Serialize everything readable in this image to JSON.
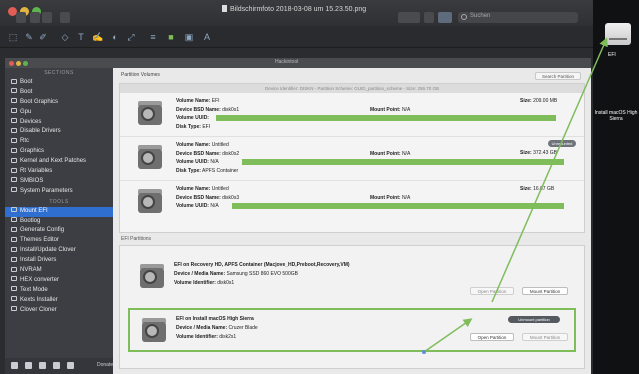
{
  "preview": {
    "document_title": "Bildschirmfoto 2018-03-08 um 15.23.50.png",
    "search_placeholder": "Suchen"
  },
  "app": {
    "window_title": "Hackintool",
    "sidebar": {
      "section_header": "SECTIONS",
      "items": [
        {
          "label": "Boot",
          "icon": "boot-icon"
        },
        {
          "label": "Boot",
          "icon": "boot-icon"
        },
        {
          "label": "Boot Graphics",
          "icon": "graphics-icon"
        },
        {
          "label": "Gpu",
          "icon": "gpu-icon"
        },
        {
          "label": "Devices",
          "icon": "devices-icon"
        },
        {
          "label": "Disable Drivers",
          "icon": "drivers-icon"
        },
        {
          "label": "Rtc",
          "icon": "rtc-icon"
        },
        {
          "label": "Graphics",
          "icon": "graphics-icon"
        },
        {
          "label": "Kernel and Kext Patches",
          "icon": "patch-icon"
        },
        {
          "label": "Rt Variables",
          "icon": "variables-icon"
        },
        {
          "label": "SMBIOS",
          "icon": "smbios-icon"
        },
        {
          "label": "System Parameters",
          "icon": "parameters-icon"
        }
      ],
      "tools_header": "TOOLS",
      "tools": [
        {
          "label": "Mount EFI",
          "icon": "mount-efi-icon",
          "active": true
        },
        {
          "label": "Bootlog",
          "icon": "bootlog-icon"
        },
        {
          "label": "Generate Config",
          "icon": "config-icon"
        },
        {
          "label": "Themes Editor",
          "icon": "themes-icon"
        },
        {
          "label": "Install/Update Clover",
          "icon": "clover-icon"
        },
        {
          "label": "Install Drivers",
          "icon": "drivers-icon"
        },
        {
          "label": "NVRAM",
          "icon": "nvram-icon"
        },
        {
          "label": "HEX converter",
          "icon": "hex-icon"
        },
        {
          "label": "Text Mode",
          "icon": "text-icon"
        },
        {
          "label": "Kexts Installer",
          "icon": "kexts-icon"
        },
        {
          "label": "Clover Cloner",
          "icon": "cloner-icon"
        }
      ],
      "donate_label": "Donate"
    },
    "main": {
      "volumes_tab": "Partition Volumes",
      "search_partition_button": "Search Partition",
      "volumes_header": "Device Identifier: DISKN - Partition Scheme: GUID_partition_scheme - Size: 256.70 GB",
      "volumes": [
        {
          "volume_name": "EFI",
          "device_bsd_name": "disk0s1",
          "mount_point": "N/A",
          "volume_uuid": "",
          "disk_type": "EFI",
          "size": "209.00 MB",
          "badge": ""
        },
        {
          "volume_name": "Untitled",
          "device_bsd_name": "disk0s2",
          "mount_point": "N/A",
          "volume_uuid": "N/A",
          "disk_type": "APFS Container",
          "size": "372.43 GB",
          "badge": "Unmounted"
        },
        {
          "volume_name": "Untitled",
          "device_bsd_name": "disk0s3",
          "mount_point": "N/A",
          "volume_uuid": "N/A",
          "disk_type": "",
          "size": "16.07 GB",
          "badge": ""
        }
      ],
      "efi_section_label": "EFI Partitions",
      "efi_partitions": [
        {
          "title": "EFI on Recovery HD, APFS Container (Macjove_HD,Preboot,Recovery,VM)",
          "device_media_name": "Samsung SSD 860 EVO 500GB",
          "volume_identifier": "disk0s1",
          "open_label": "Open Partition",
          "mount_label": "Mount Partition",
          "badge": ""
        },
        {
          "title": "EFI on Install macOS High Sierra",
          "device_media_name": "Cruzer Blade",
          "volume_identifier": "disk2s1",
          "open_label": "Open Partition",
          "mount_label": "Mount Partition",
          "badge": "Unmount partition"
        }
      ]
    }
  },
  "labels": {
    "volume_name": "Volume Name:",
    "device_bsd_name": "Device BSD Name:",
    "mount_point": "Mount Point:",
    "volume_uuid": "Volume UUID:",
    "disk_type": "Disk Type:",
    "size": "Size:",
    "device_media_name": "Device / Media Name:",
    "volume_identifier": "Volume Identifier:"
  },
  "desktop": {
    "efi_icon_label": "EFI",
    "installer_icon_label": "Install macOS High Sierra"
  },
  "colors": {
    "annotation": "#7fbd5b",
    "selection": "#2f6fd0"
  }
}
